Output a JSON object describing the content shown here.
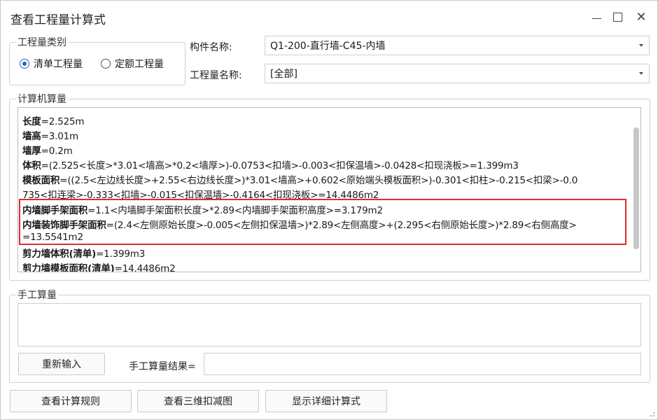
{
  "window": {
    "title": "查看工程量计算式",
    "min_icon": "minimize-icon",
    "max_icon": "maximize-icon",
    "close_icon": "close-icon",
    "close_glyph": "✕"
  },
  "quantity_type": {
    "legend": "工程量类别",
    "options": [
      "清单工程量",
      "定额工程量"
    ],
    "selected": "清单工程量"
  },
  "component": {
    "label": "构件名称:",
    "value": "Q1-200-直行墙-C45-内墙"
  },
  "quantity_name": {
    "label": "工程量名称:",
    "value": "[全部]"
  },
  "computed": {
    "legend": "计算机算量",
    "lines": [
      {
        "key": "长度",
        "text": "=2.525m"
      },
      {
        "key": "墙高",
        "text": "=3.01m"
      },
      {
        "key": "墙厚",
        "text": "=0.2m"
      },
      {
        "key": "体积",
        "text": "=(2.525<长度>*3.01<墙高>*0.2<墙厚>)-0.0753<扣墙>-0.003<扣保温墙>-0.0428<扣现浇板>=1.399m3"
      },
      {
        "key": "模板面积",
        "text": "=((2.5<左边线长度>+2.55<右边线长度>)*3.01<墙高>+0.602<原始端头模板面积>)-0.301<扣柱>-0.215<扣梁>-0.0"
      },
      {
        "key": "",
        "text": "735<扣连梁>-0.333<扣墙>-0.015<扣保温墙>-0.4164<扣现浇板>=14.4486m2"
      },
      {
        "key": "内墙脚手架面积",
        "text": "=1.1<内墙脚手架面积长度>*2.89<内墙脚手架面积高度>=3.179m2"
      },
      {
        "key": "内墙装饰脚手架面积",
        "text": "=(2.4<左侧原始长度>-0.005<左侧扣保温墙>)*2.89<左侧高度>+(2.295<右侧原始长度>)*2.89<右侧高度>"
      },
      {
        "key": "",
        "text": "=13.5541m2"
      },
      {
        "key": "剪力墙体积(清单)",
        "text": "=1.399m3"
      },
      {
        "key": "剪力墙模板面积(清单)",
        "text": "=14.4486m2"
      }
    ]
  },
  "manual": {
    "legend": "手工算量",
    "reenter_label": "重新输入",
    "result_label": "手工算量结果=",
    "result_value": ""
  },
  "footer": {
    "rules_label": "查看计算规则",
    "view3d_label": "查看三维扣减图",
    "detail_label": "显示详细计算式"
  },
  "colors": {
    "highlight": "#d9302b",
    "radio_accent": "#2a62c5"
  }
}
